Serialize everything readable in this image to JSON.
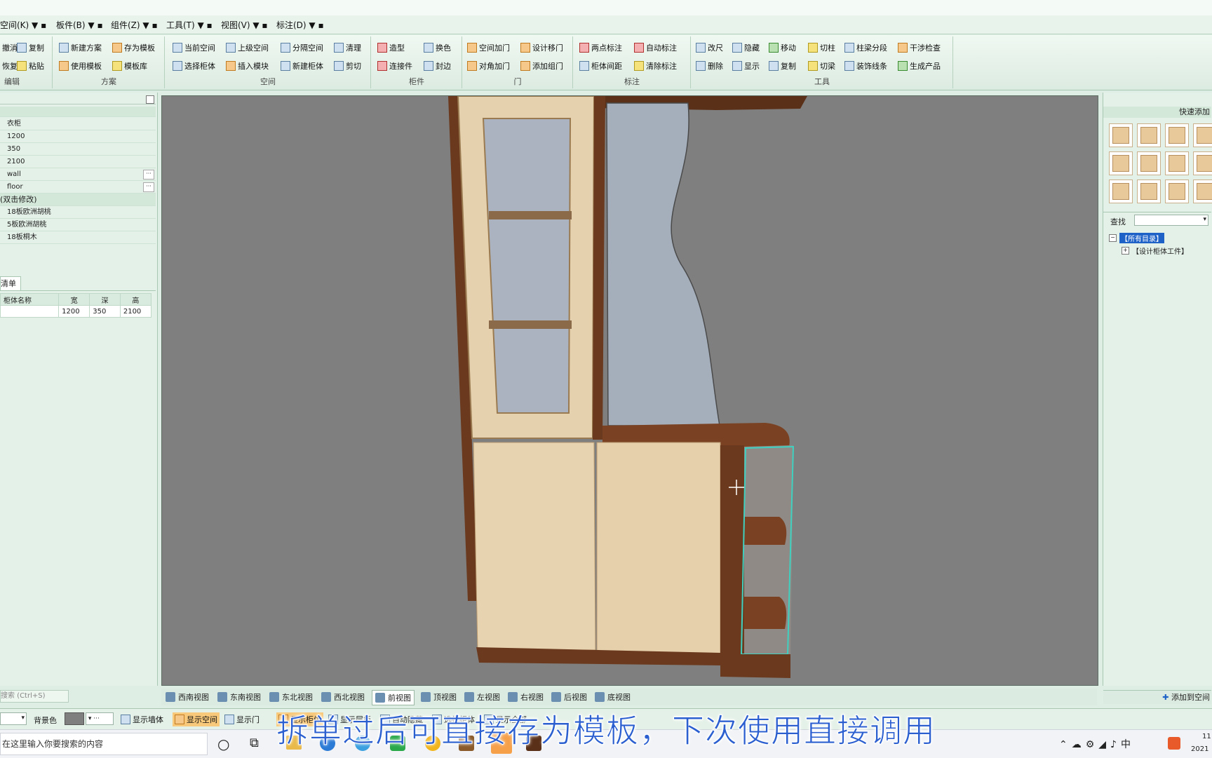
{
  "menu": [
    "空间(K) ▼ ▪",
    "板件(B) ▼ ▪",
    "组件(Z) ▼ ▪",
    "工具(T) ▼ ▪",
    "视图(V) ▼ ▪",
    "标注(D) ▼ ▪"
  ],
  "ribbon": {
    "g0": {
      "items": [
        "撤消",
        "复制",
        "恢复",
        "粘贴"
      ],
      "caption": "编辑"
    },
    "g1": {
      "items": [
        "新建方案",
        "存为模板",
        "使用模板",
        "模板库"
      ],
      "caption": "方案"
    },
    "g2": {
      "items": [
        "当前空间",
        "上级空间",
        "分隔空间",
        "清理",
        "选择柜体",
        "插入模块",
        "新建柜体",
        "剪切"
      ],
      "caption": "空间"
    },
    "g3": {
      "items": [
        "造型",
        "换色",
        "连接件",
        "封边"
      ],
      "caption": "柜件"
    },
    "g4": {
      "items": [
        "空间加门",
        "设计移门",
        "对角加门",
        "添加组门"
      ],
      "caption": "门"
    },
    "g5": {
      "items": [
        "两点标注",
        "自动标注",
        "柜体间距",
        "清除标注"
      ],
      "caption": "标注"
    },
    "g6": {
      "items": [
        "改尺",
        "隐藏",
        "移动",
        "切柱",
        "柱梁分段",
        "干涉检查",
        "删除",
        "显示",
        "复制",
        "切梁",
        "装饰线条",
        "生成产品"
      ],
      "caption": "工具"
    }
  },
  "left": {
    "props": [
      "衣柜",
      "1200",
      "350",
      "2100",
      "wall",
      "floor"
    ],
    "section": "(双击修改)",
    "materials": [
      "18板欧洲胡桃",
      "5板欧洲胡桃",
      "18板桐木"
    ],
    "tab": "清单",
    "table": {
      "headers": [
        "柜体名称",
        "宽",
        "深",
        "高"
      ],
      "rows": [
        [
          "",
          "1200",
          "350",
          "2100"
        ]
      ]
    },
    "search_hint": "搜索 (Ctrl+S)"
  },
  "viewtabs": [
    "西南视图",
    "东南视图",
    "东北视图",
    "西北视图",
    "前视图",
    "顶视图",
    "左视图",
    "右视图",
    "后视图",
    "底视图"
  ],
  "active_view": "前视图",
  "right": {
    "title": "快速添加",
    "search_label": "查找",
    "tree": [
      "【所有目录】",
      "【设计柜体工件】"
    ],
    "add_button": "添加到空间"
  },
  "bottombar": {
    "bg_label": "背景色",
    "buttons": [
      "显示墙体",
      "显示空间",
      "显示门",
      "显示柜体",
      "显示层板",
      "自动隐藏",
      "选择柜体",
      "显示全部"
    ]
  },
  "taskbar": {
    "search_placeholder": "在这里输入你要搜索的内容",
    "clock_time": "11",
    "clock_date": "2021"
  },
  "subtitle": "拆单过后可直接存为模板，下次使用直接调用",
  "colors": {
    "viewport": "#7f7f7f",
    "wood_dark": "#6b3a1e",
    "wood_light": "#e8d3b0",
    "selection": "#3fd0c0",
    "subtitle": "#2b5fd0"
  }
}
